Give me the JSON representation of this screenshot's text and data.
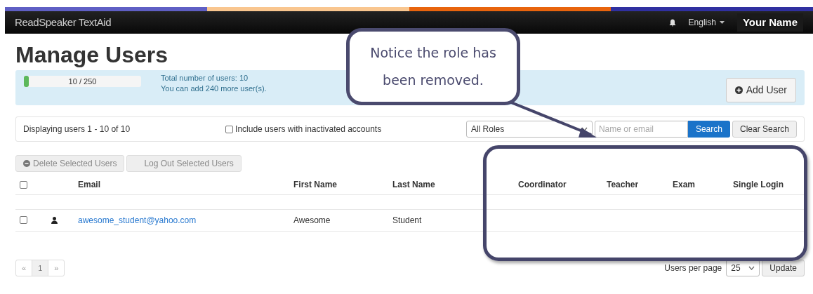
{
  "navbar": {
    "brand": "ReadSpeaker TextAid",
    "language": "English",
    "user_name": "Your Name"
  },
  "page_title": "Manage Users",
  "quota": {
    "label": "10 / 250",
    "level": 0.04,
    "total_text": "Total number of users: 10",
    "remaining_text": "You can add 240 more user(s)."
  },
  "add_user_button": "Add User",
  "filter": {
    "displaying": "Displaying users 1 - 10 of 10",
    "include_inactive": {
      "label": "Include users with inactivated accounts",
      "checked": false
    },
    "role_select": "All Roles",
    "search_placeholder": "Name or email",
    "search_button": "Search",
    "clear_button": "Clear Search"
  },
  "actions": [
    "Delete Selected Users",
    "Log Out Selected Users"
  ],
  "table": {
    "select_all_checked": false,
    "columns": [
      "Email",
      "First Name",
      "Last Name",
      "Coordinator",
      "Teacher",
      "Exam",
      "Single Login"
    ],
    "rows": [
      {
        "checked": false,
        "email": "awesome_student@yahoo.com",
        "first_name": "Awesome",
        "last_name": "Student"
      }
    ]
  },
  "pagination": [
    {
      "label": "«",
      "selected": false
    },
    {
      "label": "1",
      "selected": true
    },
    {
      "label": "»",
      "selected": false
    }
  ],
  "per_page": {
    "label": "Users per page",
    "value": "25",
    "update_button": "Update"
  },
  "annotation": {
    "lines": [
      "Notice the role has",
      "been removed."
    ]
  }
}
